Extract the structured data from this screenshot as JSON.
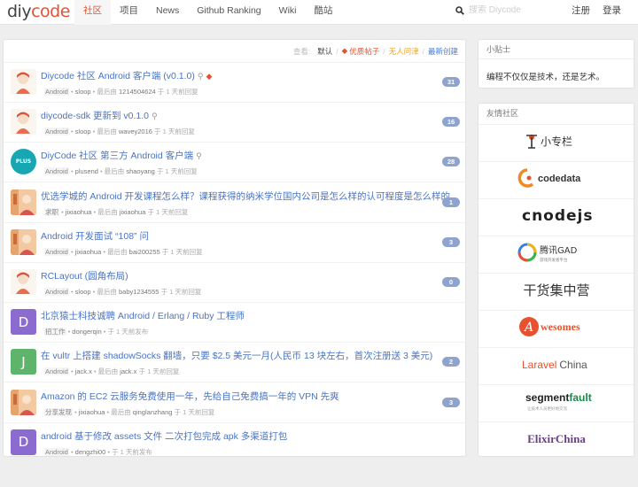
{
  "brand": {
    "logo_dy": "diy",
    "logo_code": "code"
  },
  "nav": [
    {
      "label": "社区",
      "active": true
    },
    {
      "label": "项目"
    },
    {
      "label": "News"
    },
    {
      "label": "Github Ranking"
    },
    {
      "label": "Wiki"
    },
    {
      "label": "酷站"
    }
  ],
  "search": {
    "placeholder": "搜索 Diycode"
  },
  "auth": {
    "register": "注册",
    "login": "登录"
  },
  "filter": {
    "label": "查看:",
    "tabs": [
      "默认",
      "优质帖子",
      "无人问津",
      "最新创建"
    ]
  },
  "topics": [
    {
      "title": "Diycode 社区 Android 客户端 (v0.1.0)",
      "node": "Android",
      "user": "sloop",
      "reply_prefix": "最后由",
      "reply_user": "1214504624",
      "time": "于 1 天前回复",
      "count": "31",
      "avatar": "anime",
      "pinned": true,
      "excellent": true
    },
    {
      "title": "diycode-sdk 更新到 v0.1.0",
      "node": "Android",
      "user": "sloop",
      "reply_prefix": "最后由",
      "reply_user": "wavey2016",
      "time": "于 1 天前回复",
      "count": "16",
      "avatar": "anime",
      "pinned": true
    },
    {
      "title": "DiyCode 社区 第三方 Android 客户端",
      "node": "Android",
      "user": "plusend",
      "reply_prefix": "最后由",
      "reply_user": "shaoyang",
      "time": "于 1 天前回复",
      "count": "28",
      "avatar": "teal",
      "avatar_text": "PLUS",
      "pinned": true
    },
    {
      "title": "优选学城的 Android 开发课程怎么样？课程获得的纳米学位国内公司是怎么样的认可程度是怎么样的",
      "node": "求职",
      "user": "jixiaohua",
      "reply_prefix": "最后由",
      "reply_user": "jixiaohua",
      "time": "于 1 天前回复",
      "count": "1",
      "avatar": "photo"
    },
    {
      "title": "Android 开发面试 “108” 问",
      "node": "Android",
      "user": "jixiaohua",
      "reply_prefix": "最后由",
      "reply_user": "bai200255",
      "time": "于 1 天前回复",
      "count": "3",
      "avatar": "photo"
    },
    {
      "title": "RCLayout (圆角布局)",
      "node": "Android",
      "user": "sloop",
      "reply_prefix": "最后由",
      "reply_user": "baby1234555",
      "time": "于 1 天前回复",
      "count": "0",
      "avatar": "anime"
    },
    {
      "title": "北京猿士科技诚聘 Android / Erlang / Ruby 工程师",
      "node": "招工作",
      "user": "dongerqin",
      "reply_prefix": "",
      "reply_user": "",
      "time": "于 1 天前发布",
      "count": "",
      "avatar": "letter-d",
      "avatar_text": "D"
    },
    {
      "title": "在 vultr 上搭建 shadowSocks 翻墙，只要 $2.5 美元一月(人民币 13 块左右，首次注册送 3 美元)",
      "node": "Android",
      "user": "jack.x",
      "reply_prefix": "最后由",
      "reply_user": "jack.x",
      "time": "于 1 天前回复",
      "count": "2",
      "avatar": "letter-j",
      "avatar_text": "J"
    },
    {
      "title": "Amazon 的 EC2 云服务免费使用一年，先给自己免费搞一年的 VPN 先爽",
      "node": "分享发现",
      "user": "jixiaohua",
      "reply_prefix": "最后由",
      "reply_user": "qinglanzhang",
      "time": "于 1 天前回复",
      "count": "3",
      "avatar": "photo"
    },
    {
      "title": "android 基于修改 assets 文件 二次打包完成 apk 多渠道打包",
      "node": "Android",
      "user": "dengzhi00",
      "reply_prefix": "",
      "reply_user": "",
      "time": "于 1 天前发布",
      "count": "",
      "avatar": "letter-d",
      "avatar_text": "D"
    }
  ],
  "sidebar": {
    "tips_title": "小贴士",
    "tips_text": "编程不仅仅是技术，还是艺术。",
    "friends_title": "友情社区",
    "friends": [
      {
        "name": "小专栏"
      },
      {
        "name": "codedata"
      },
      {
        "name": "cnodejs"
      },
      {
        "name": "腾讯GAD",
        "sub": "游戏开发者平台"
      },
      {
        "name": "干货集中营"
      },
      {
        "name": "wesomes",
        "initial": "A"
      },
      {
        "name_a": "Laravel",
        "name_b": "China"
      },
      {
        "name_a": "segment",
        "name_b": "fault",
        "sub": "让技术人员更好地交流"
      },
      {
        "name": "ElixirChina"
      }
    ]
  },
  "colors": {
    "brand": "#e8512f",
    "link": "#4a74c4",
    "badge": "#8ea4cf"
  }
}
